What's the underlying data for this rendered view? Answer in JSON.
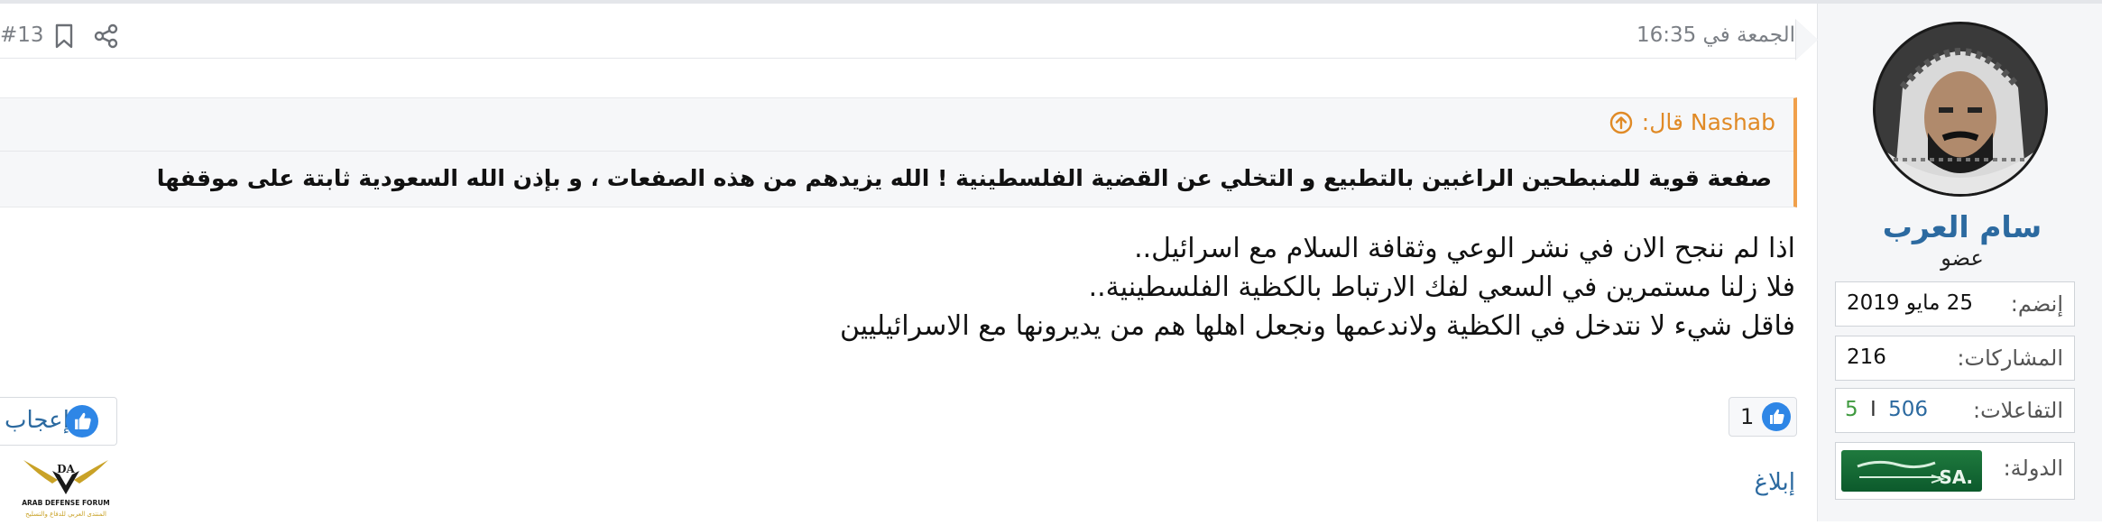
{
  "post": {
    "date": "الجمعة في 16:35",
    "number": "#13",
    "share_icon": "share-icon",
    "bookmark_icon": "bookmark-icon"
  },
  "quote": {
    "author": "Nashab قال:",
    "text": "صفعة قوية للمنبطحين الراغبين بالتطبيع و التخلي عن القضية الفلسطينية ! الله يزيدهم من هذه الصفعات ، و بإذن الله السعودية ثابتة على موقفها"
  },
  "message": {
    "lines": [
      "اذا لم ننجح الان في نشر الوعي وثقافة السلام مع اسرائيل..",
      "فلا زلنا مستمرين في السعي لفك الارتباط بالكظية الفلسطينية..",
      "فاقل شيء لا نتدخل في الكظية ولاندعمها ونجعل اهلها هم من يديرونها مع الاسرائيليين"
    ]
  },
  "reactions": {
    "count": "1",
    "like_label": "إعجاب",
    "report_label": "إبلاغ"
  },
  "user": {
    "name": "سام العرب",
    "title": "عضو",
    "joined_label": "إنضم:",
    "joined_value": "25 مايو 2019",
    "posts_label": "المشاركات:",
    "posts_value": "216",
    "reactions_label": "التفاعلات:",
    "reactions_positive": "506",
    "reactions_sep": "I",
    "reactions_other": "5",
    "country_label": "الدولة:",
    "flag_text": ".SA"
  },
  "logo": {
    "text_en": "ARAB DEFENSE FORUM",
    "text_ar": "المنتدى العربي للدفاع والتسليح",
    "mark": "DA"
  },
  "colors": {
    "link": "#2c6aa0",
    "quote_accent": "#f0a04b",
    "reaction_blue": "#2e86e6",
    "positive_green": "#3f9a3f"
  }
}
